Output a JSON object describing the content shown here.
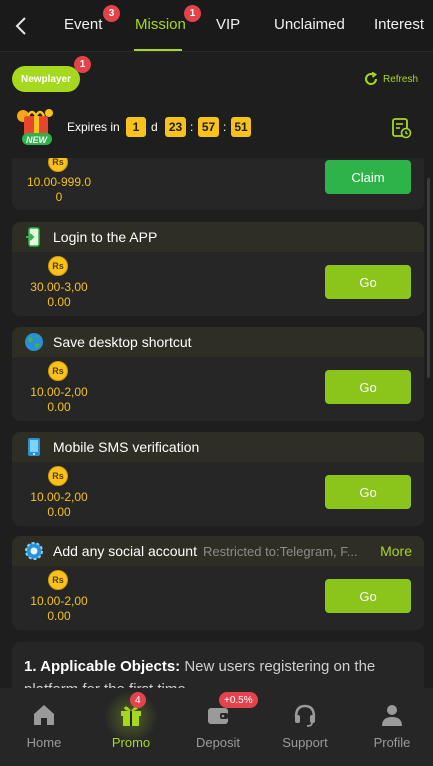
{
  "tabs": [
    {
      "label": "Event",
      "badge": "3"
    },
    {
      "label": "Mission",
      "badge": "1",
      "active": true
    },
    {
      "label": "VIP"
    },
    {
      "label": "Unclaimed"
    },
    {
      "label": "Interest"
    }
  ],
  "header": {
    "newplayer_label": "Newplayer",
    "newplayer_badge": "1",
    "refresh_label": "Refresh",
    "gift_label": "NEW",
    "expires_label": "Expires in",
    "countdown": {
      "days": "1",
      "day_unit": "d",
      "hours": "23",
      "minutes": "57",
      "seconds": "51",
      "sep": ":"
    }
  },
  "missions": [
    {
      "title": "",
      "amount_line1": "10.00-999.0",
      "amount_line2": "0",
      "button": "Claim",
      "currency": "Rs"
    },
    {
      "title": "Login to the APP",
      "amount_line1": "30.00-3,00",
      "amount_line2": "0.00",
      "button": "Go",
      "currency": "Rs",
      "icon": "phone-app-icon"
    },
    {
      "title": "Save desktop shortcut",
      "amount_line1": "10.00-2,00",
      "amount_line2": "0.00",
      "button": "Go",
      "currency": "Rs",
      "icon": "globe-icon"
    },
    {
      "title": "Mobile SMS verification",
      "amount_line1": "10.00-2,00",
      "amount_line2": "0.00",
      "button": "Go",
      "currency": "Rs",
      "icon": "mobile-sms-icon"
    },
    {
      "title": "Add any social account",
      "subtitle": "Restricted to:Telegram, F...",
      "more": "More",
      "amount_line1": "10.00-2,00",
      "amount_line2": "0.00",
      "button": "Go",
      "currency": "Rs",
      "icon": "social-gear-icon"
    }
  ],
  "rules": {
    "heading": "1. Applicable Objects:",
    "text": " New users registering on the platform for the first time"
  },
  "bottom_nav": [
    {
      "label": "Home",
      "icon": "home-icon"
    },
    {
      "label": "Promo",
      "icon": "gift-icon",
      "badge": "4",
      "active": true
    },
    {
      "label": "Deposit",
      "icon": "wallet-icon",
      "badge": "+0.5%"
    },
    {
      "label": "Support",
      "icon": "headset-icon"
    },
    {
      "label": "Profile",
      "icon": "user-icon"
    }
  ],
  "colors": {
    "accent": "#a6d81e",
    "gold": "#f6c21b",
    "badge": "#e5434b",
    "claim": "#2db34a"
  }
}
